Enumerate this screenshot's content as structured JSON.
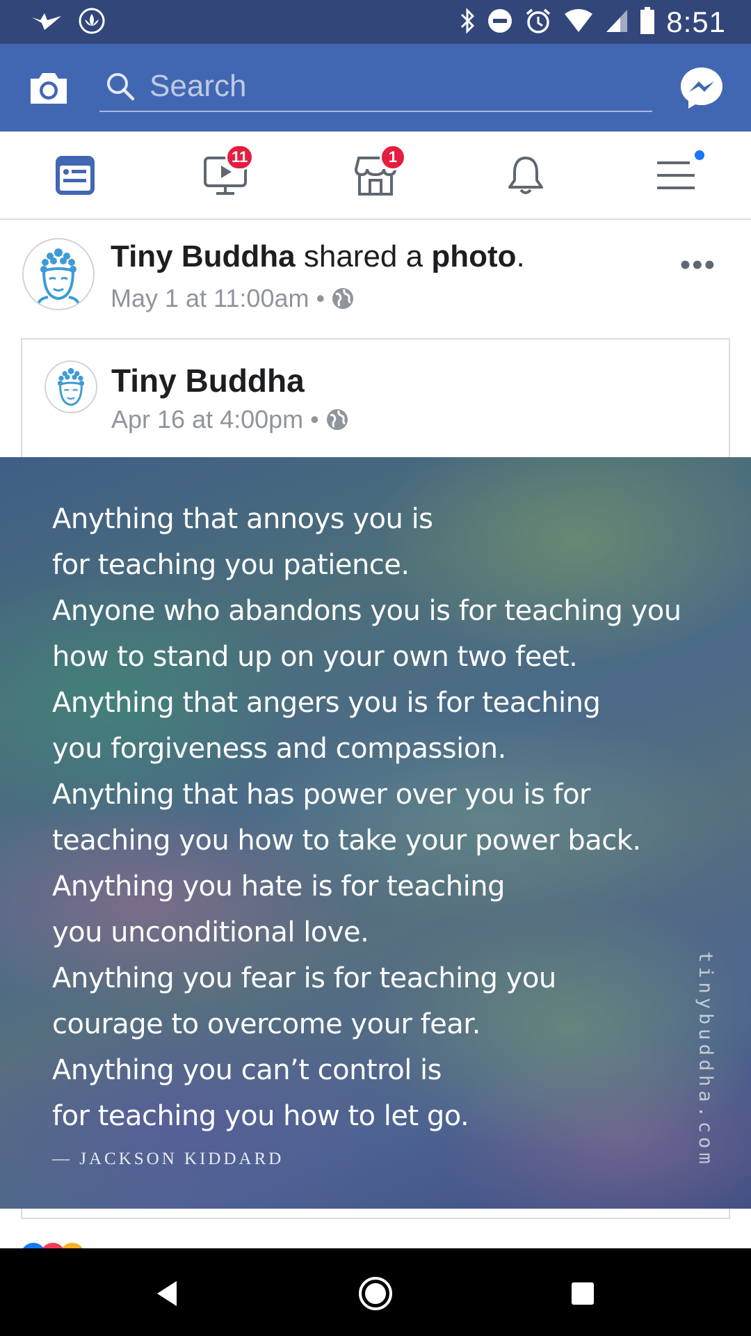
{
  "status_bar": {
    "time": "8:51",
    "icons": [
      "bird-icon",
      "lotus-icon",
      "bluetooth-icon",
      "do-not-disturb-icon",
      "alarm-icon",
      "wifi-icon",
      "signal-icon",
      "battery-icon"
    ]
  },
  "app_bar": {
    "search_placeholder": "Search",
    "brand_color": "#4267b2"
  },
  "tabs": [
    {
      "name": "news-feed",
      "icon": "news-feed-icon",
      "active": true
    },
    {
      "name": "watch",
      "icon": "video-icon",
      "badge": "11"
    },
    {
      "name": "marketplace",
      "icon": "store-icon",
      "badge": "1"
    },
    {
      "name": "notifications",
      "icon": "bell-icon"
    },
    {
      "name": "menu",
      "icon": "menu-icon",
      "dot": true
    }
  ],
  "post": {
    "author": "Tiny Buddha",
    "action_text": " shared a ",
    "object": "photo",
    "punct": ".",
    "timestamp": "May 1 at 11:00am",
    "separator": "•",
    "privacy_icon": "globe-icon",
    "more": "•••"
  },
  "shared": {
    "author": "Tiny Buddha",
    "timestamp": "Apr 16 at 4:00pm",
    "separator": "•",
    "privacy_icon": "globe-icon"
  },
  "quote": {
    "lines": [
      "Anything that annoys you is",
      "for teaching you patience.",
      "Anyone who abandons you is for teaching you",
      "how to stand up on your own two feet.",
      "Anything that angers you is for teaching",
      "you forgiveness and compassion.",
      "Anything that has power over you is for",
      "teaching you how to take your power back.",
      "Anything you hate is for teaching",
      "you unconditional love.",
      "Anything you fear is for teaching you",
      "courage to  overcome your fear.",
      "Anything you can’t control is",
      "for teaching you how to let go."
    ],
    "author": "— JACKSON KIDDARD",
    "watermark": "tinybuddha.com"
  },
  "nav_bar": {
    "buttons": [
      "back-icon",
      "home-icon",
      "recents-icon"
    ]
  }
}
